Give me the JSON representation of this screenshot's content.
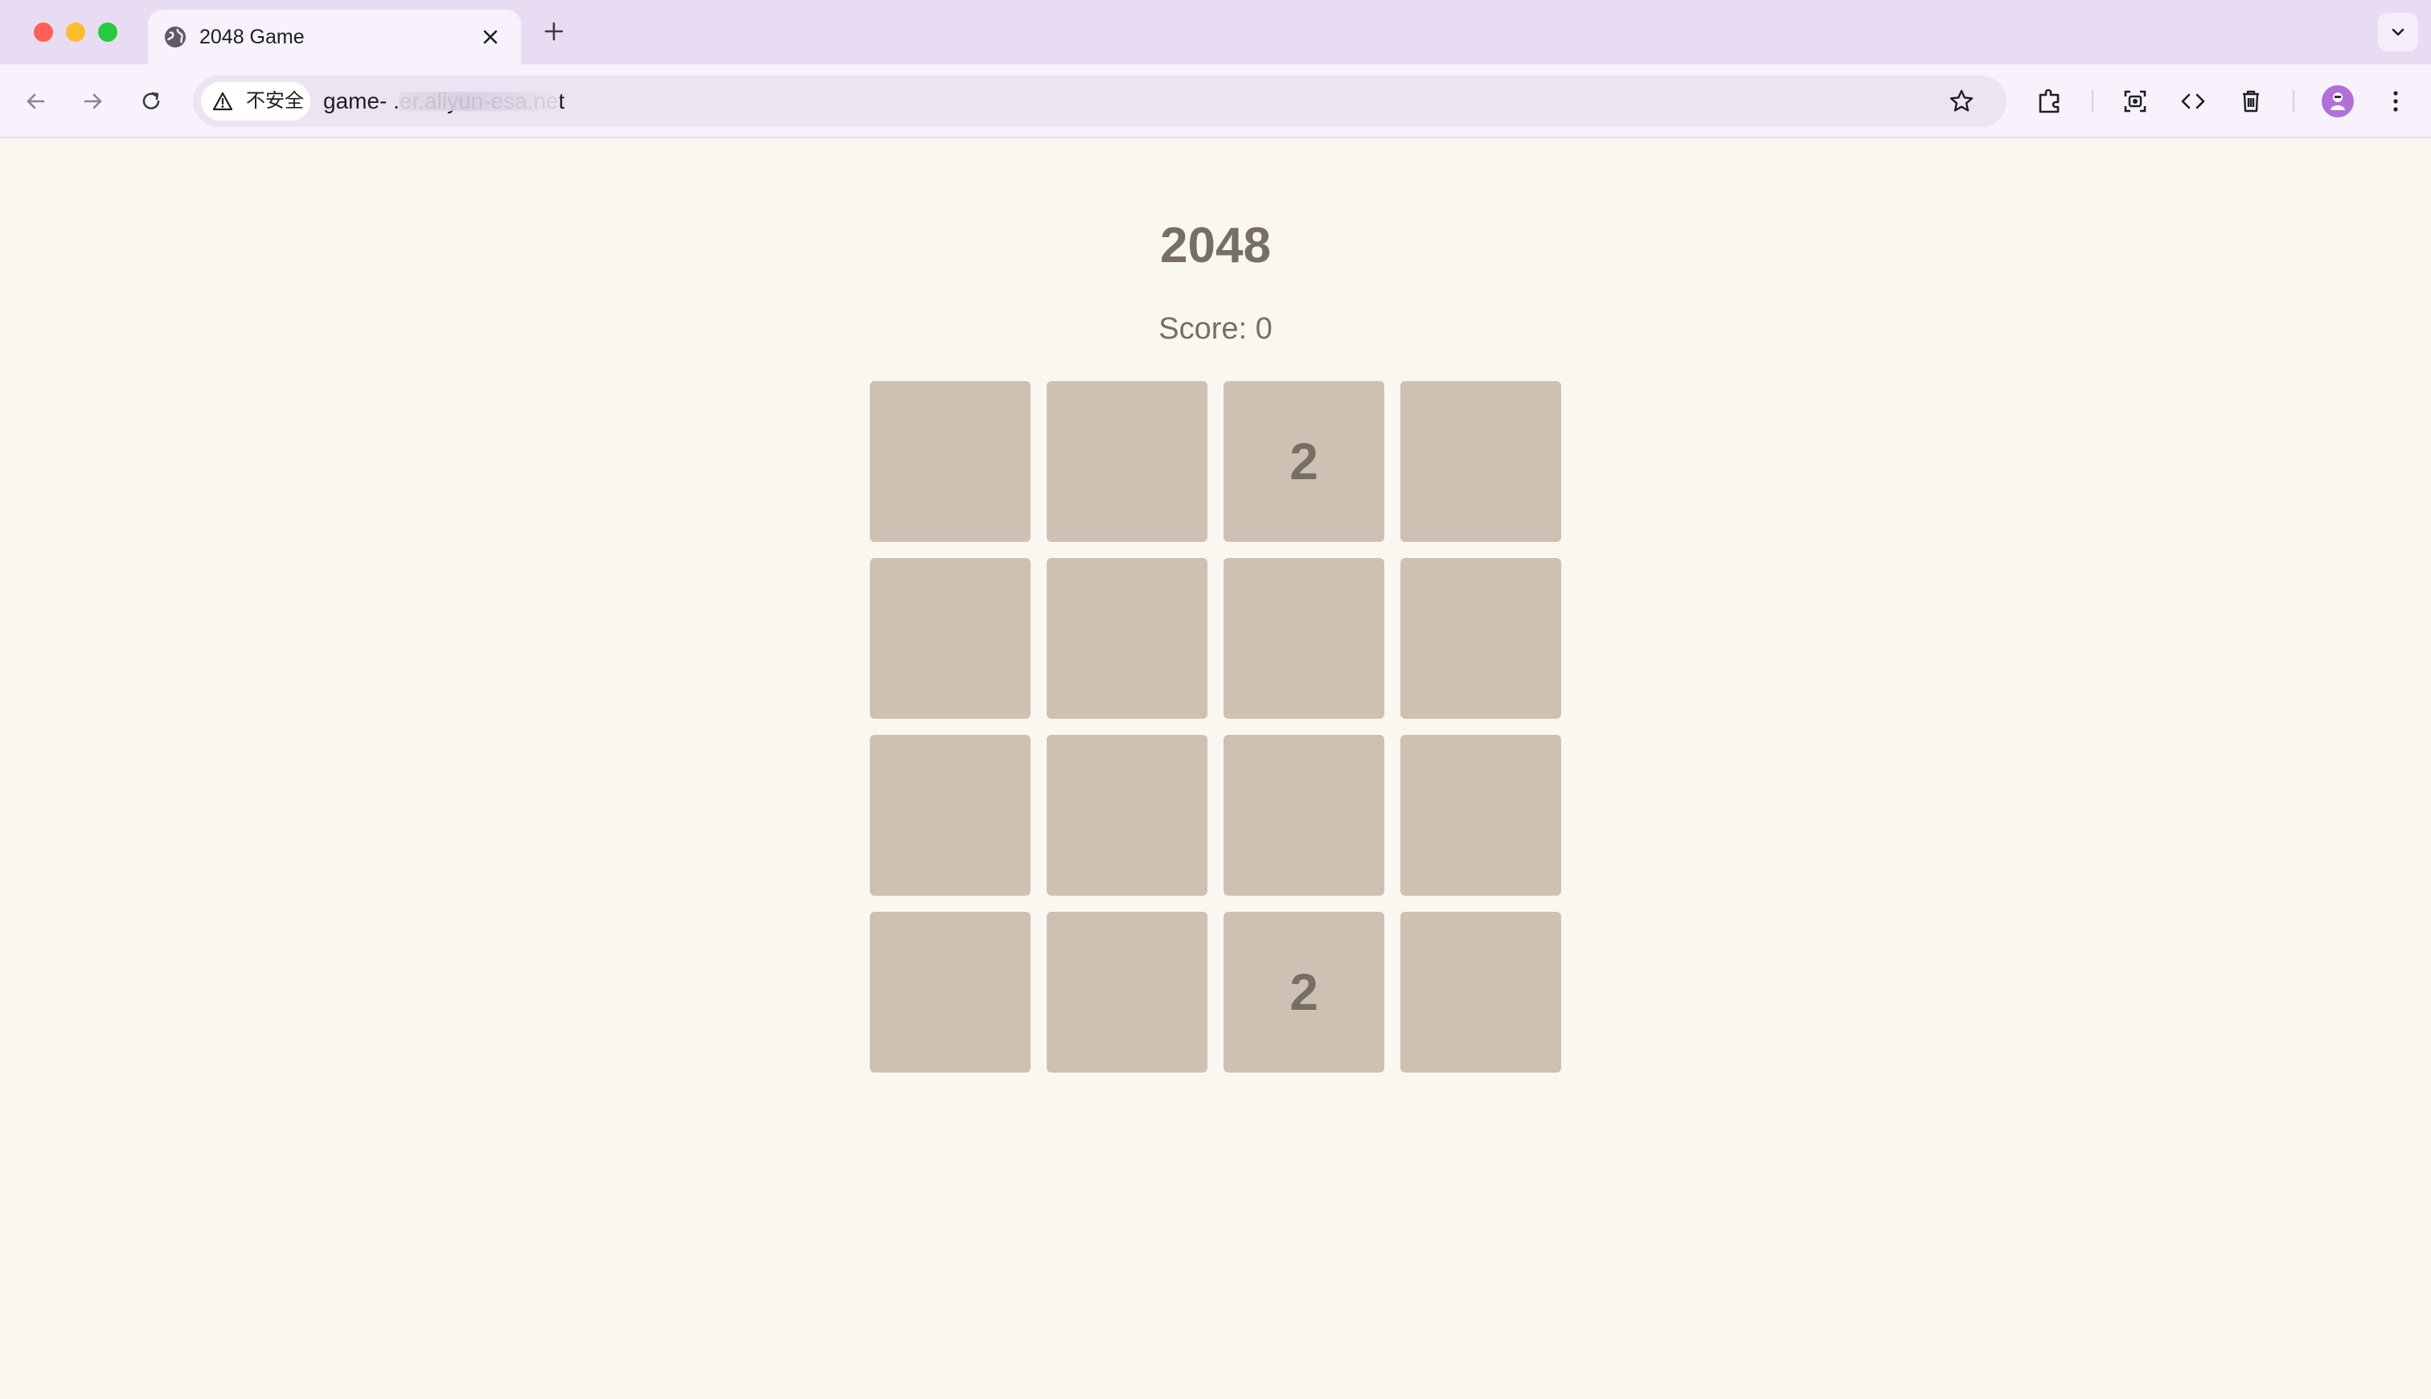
{
  "browser": {
    "tab_title": "2048 Game",
    "security_label": "不安全",
    "url": "game-                          .er.aliyun-esa.net"
  },
  "game": {
    "title": "2048",
    "score_label": "Score:",
    "score": "0",
    "board": [
      [
        "",
        "",
        "2",
        ""
      ],
      [
        "",
        "",
        "",
        ""
      ],
      [
        "",
        "",
        "",
        ""
      ],
      [
        "",
        "",
        "2",
        ""
      ]
    ]
  },
  "colors": {
    "page_background": "#faf7f0",
    "cell_background": "#cdc1b4",
    "text": "#776e65",
    "tabbar": "#e8dcf3"
  },
  "icons": [
    "globe-icon",
    "close-icon",
    "plus-icon",
    "chevron-down-icon",
    "back-icon",
    "forward-icon",
    "reload-icon",
    "warning-icon",
    "star-icon",
    "extensions-icon",
    "screenshot-icon",
    "code-icon",
    "trash-icon",
    "avatar",
    "more-icon"
  ]
}
